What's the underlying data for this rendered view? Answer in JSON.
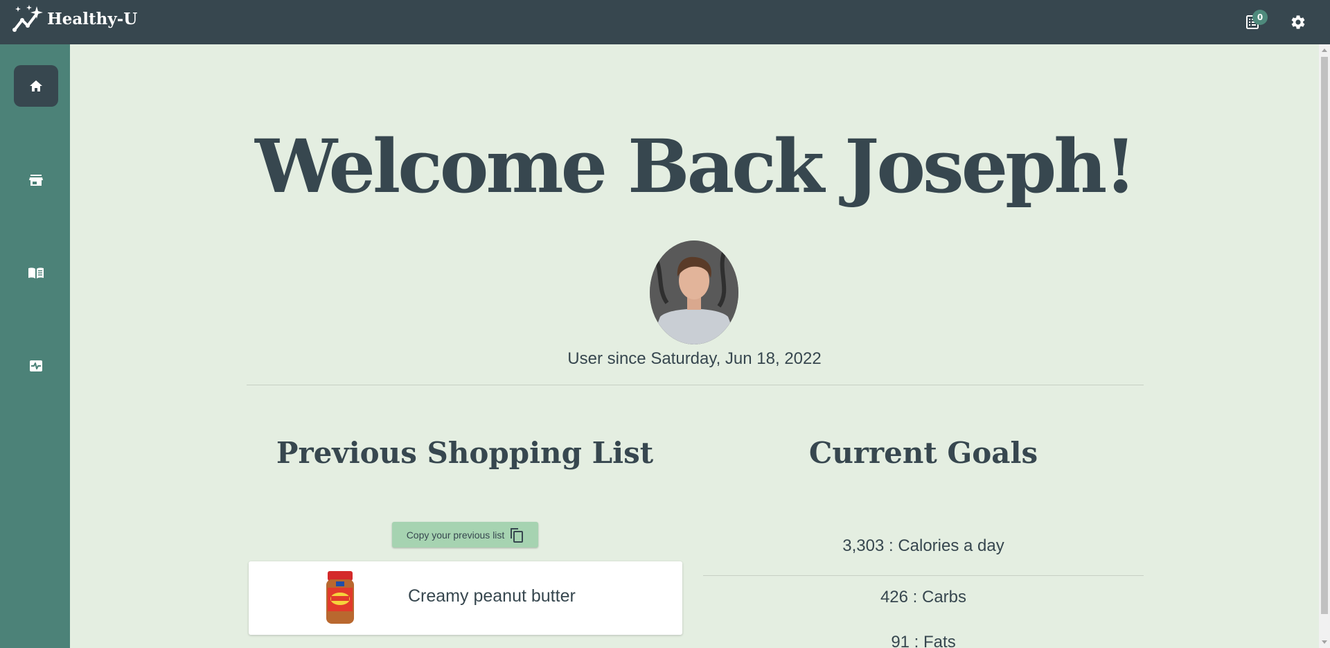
{
  "app": {
    "name": "Healthy-U",
    "brand_icon": "sparkle-trend-icon",
    "badge_count": "0",
    "colors": {
      "topbar": "#37474f",
      "sidebar": "#4c8278",
      "background": "#e4eee1",
      "badge": "#4e8a7c",
      "copy_button": "#a6d3b1"
    }
  },
  "header": {
    "actions": [
      {
        "icon": "list-icon",
        "badge": "0"
      },
      {
        "icon": "gear-icon"
      }
    ]
  },
  "sidebar": {
    "items": [
      {
        "icon": "home-icon",
        "active": true
      },
      {
        "icon": "store-icon",
        "active": false
      },
      {
        "icon": "book-icon",
        "active": false
      },
      {
        "icon": "health-monitor-icon",
        "active": false
      }
    ]
  },
  "main": {
    "welcome": "Welcome Back Joseph!",
    "user_since": "User since Saturday, Jun 18, 2022",
    "shopping": {
      "title": "Previous Shopping List",
      "copy_label": "Copy your previous list",
      "items": [
        {
          "name": "Creamy peanut butter",
          "image": "peanut-butter-jar"
        }
      ]
    },
    "goals": {
      "title": "Current Goals",
      "items": [
        "3,303 : Calories a day",
        "426 : Carbs",
        "91 : Fats"
      ]
    }
  }
}
